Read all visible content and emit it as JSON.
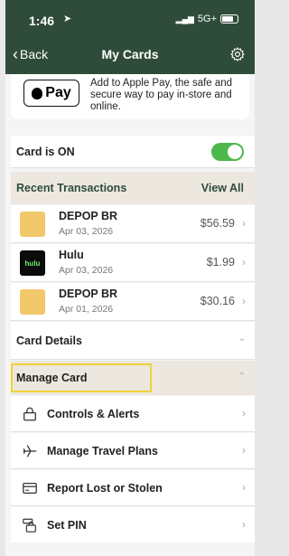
{
  "status": {
    "time": "1:46",
    "network": "5G+"
  },
  "nav": {
    "back_label": "Back",
    "title": "My Cards"
  },
  "apple_pay": {
    "badge": "Pay",
    "text": "Add to Apple Pay, the safe and secure way to pay in-store and online."
  },
  "card_status": {
    "label": "Card is ON",
    "on": true
  },
  "recent": {
    "title": "Recent Transactions",
    "view_all": "View All",
    "items": [
      {
        "name": "DEPOP BR",
        "date": "Apr 03, 2026",
        "amount": "$56.59",
        "logo": "shopping-bag-icon"
      },
      {
        "name": "Hulu",
        "date": "Apr 03, 2026",
        "amount": "$1.99",
        "logo": "hulu"
      },
      {
        "name": "DEPOP BR",
        "date": "Apr 01, 2026",
        "amount": "$30.16",
        "logo": "shopping-bag-icon"
      }
    ]
  },
  "card_details": {
    "label": "Card Details"
  },
  "manage_card": {
    "title": "Manage Card",
    "items": [
      {
        "label": "Controls & Alerts",
        "icon": "lock-icon"
      },
      {
        "label": "Manage Travel Plans",
        "icon": "airplane-icon"
      },
      {
        "label": "Report Lost or Stolen",
        "icon": "card-icon"
      },
      {
        "label": "Set PIN",
        "icon": "pin-icon"
      }
    ]
  },
  "colors": {
    "header": "#2f4c3a",
    "toggle": "#4cb84a",
    "highlight": "#f0d23a",
    "section": "#ece8df"
  }
}
